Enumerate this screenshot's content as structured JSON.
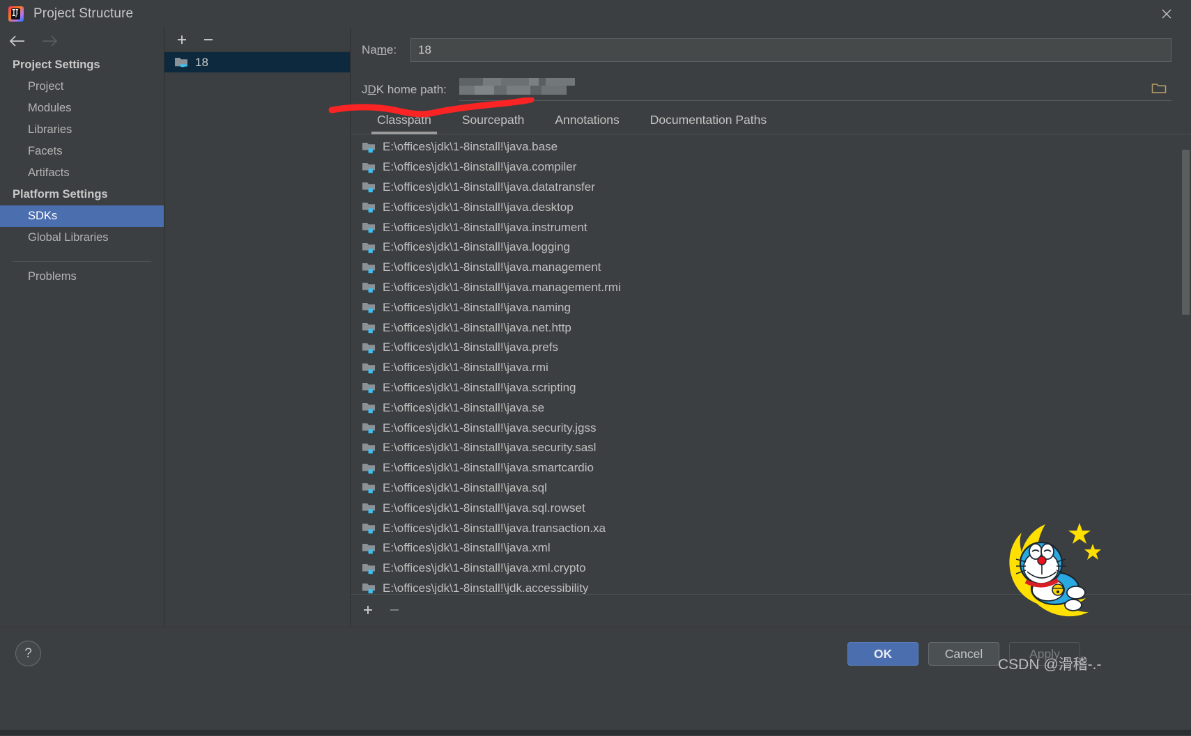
{
  "window": {
    "title": "Project Structure",
    "app_icon": "intellij-idea-icon",
    "close_icon": "close-icon"
  },
  "sidebar": {
    "back_icon": "arrow-left-icon",
    "forward_icon": "arrow-right-icon",
    "sections": [
      {
        "header": "Project Settings",
        "items": [
          {
            "label": "Project",
            "selected": false
          },
          {
            "label": "Modules",
            "selected": false
          },
          {
            "label": "Libraries",
            "selected": false
          },
          {
            "label": "Facets",
            "selected": false
          },
          {
            "label": "Artifacts",
            "selected": false
          }
        ]
      },
      {
        "header": "Platform Settings",
        "items": [
          {
            "label": "SDKs",
            "selected": true
          },
          {
            "label": "Global Libraries",
            "selected": false
          }
        ]
      }
    ],
    "problems_label": "Problems"
  },
  "tree_panel": {
    "add_icon": "plus-icon",
    "remove_icon": "minus-icon",
    "items": [
      {
        "label": "18",
        "icon": "jdk-folder-icon",
        "selected": true
      }
    ]
  },
  "detail": {
    "name_label_before": "Na",
    "name_label_mnemonic": "m",
    "name_label_after": "e:",
    "name_value": "18",
    "jdk_label_before": "J",
    "jdk_label_mnemonic": "D",
    "jdk_label_after": "K home path:",
    "jdk_value": "",
    "jdk_redacted": true,
    "browse_icon": "folder-browse-icon",
    "tabs": [
      {
        "label": "Classpath",
        "active": true
      },
      {
        "label": "Sourcepath",
        "active": false
      },
      {
        "label": "Annotations",
        "active": false
      },
      {
        "label": "Documentation Paths",
        "active": false
      }
    ],
    "list_add_icon": "plus-icon",
    "list_remove_icon": "minus-icon",
    "classpath_entries": [
      "E:\\offices\\jdk\\1-8install!\\java.base",
      "E:\\offices\\jdk\\1-8install!\\java.compiler",
      "E:\\offices\\jdk\\1-8install!\\java.datatransfer",
      "E:\\offices\\jdk\\1-8install!\\java.desktop",
      "E:\\offices\\jdk\\1-8install!\\java.instrument",
      "E:\\offices\\jdk\\1-8install!\\java.logging",
      "E:\\offices\\jdk\\1-8install!\\java.management",
      "E:\\offices\\jdk\\1-8install!\\java.management.rmi",
      "E:\\offices\\jdk\\1-8install!\\java.naming",
      "E:\\offices\\jdk\\1-8install!\\java.net.http",
      "E:\\offices\\jdk\\1-8install!\\java.prefs",
      "E:\\offices\\jdk\\1-8install!\\java.rmi",
      "E:\\offices\\jdk\\1-8install!\\java.scripting",
      "E:\\offices\\jdk\\1-8install!\\java.se",
      "E:\\offices\\jdk\\1-8install!\\java.security.jgss",
      "E:\\offices\\jdk\\1-8install!\\java.security.sasl",
      "E:\\offices\\jdk\\1-8install!\\java.smartcardio",
      "E:\\offices\\jdk\\1-8install!\\java.sql",
      "E:\\offices\\jdk\\1-8install!\\java.sql.rowset",
      "E:\\offices\\jdk\\1-8install!\\java.transaction.xa",
      "E:\\offices\\jdk\\1-8install!\\java.xml",
      "E:\\offices\\jdk\\1-8install!\\java.xml.crypto",
      "E:\\offices\\jdk\\1-8install!\\jdk.accessibility"
    ]
  },
  "bottom": {
    "help_label": "?",
    "ok_label": "OK",
    "cancel_label": "Cancel",
    "apply_label": "Apply"
  },
  "overlay": {
    "watermark": "CSDN @滑稽-.-",
    "annotation": "red-underline-annotation",
    "sticker": "doraemon-moon-sticker"
  },
  "colors": {
    "window_bg": "#3c3f41",
    "accent_selected": "#4b6eaf",
    "tree_selected": "#0d293e",
    "text": "#bbbbbb",
    "annotation_red": "#fb2424",
    "folder_icon": "#8a9297",
    "folder_badge": "#3ec1f0",
    "moon_yellow": "#ffe000",
    "doraemon_blue": "#2aa8e0"
  }
}
